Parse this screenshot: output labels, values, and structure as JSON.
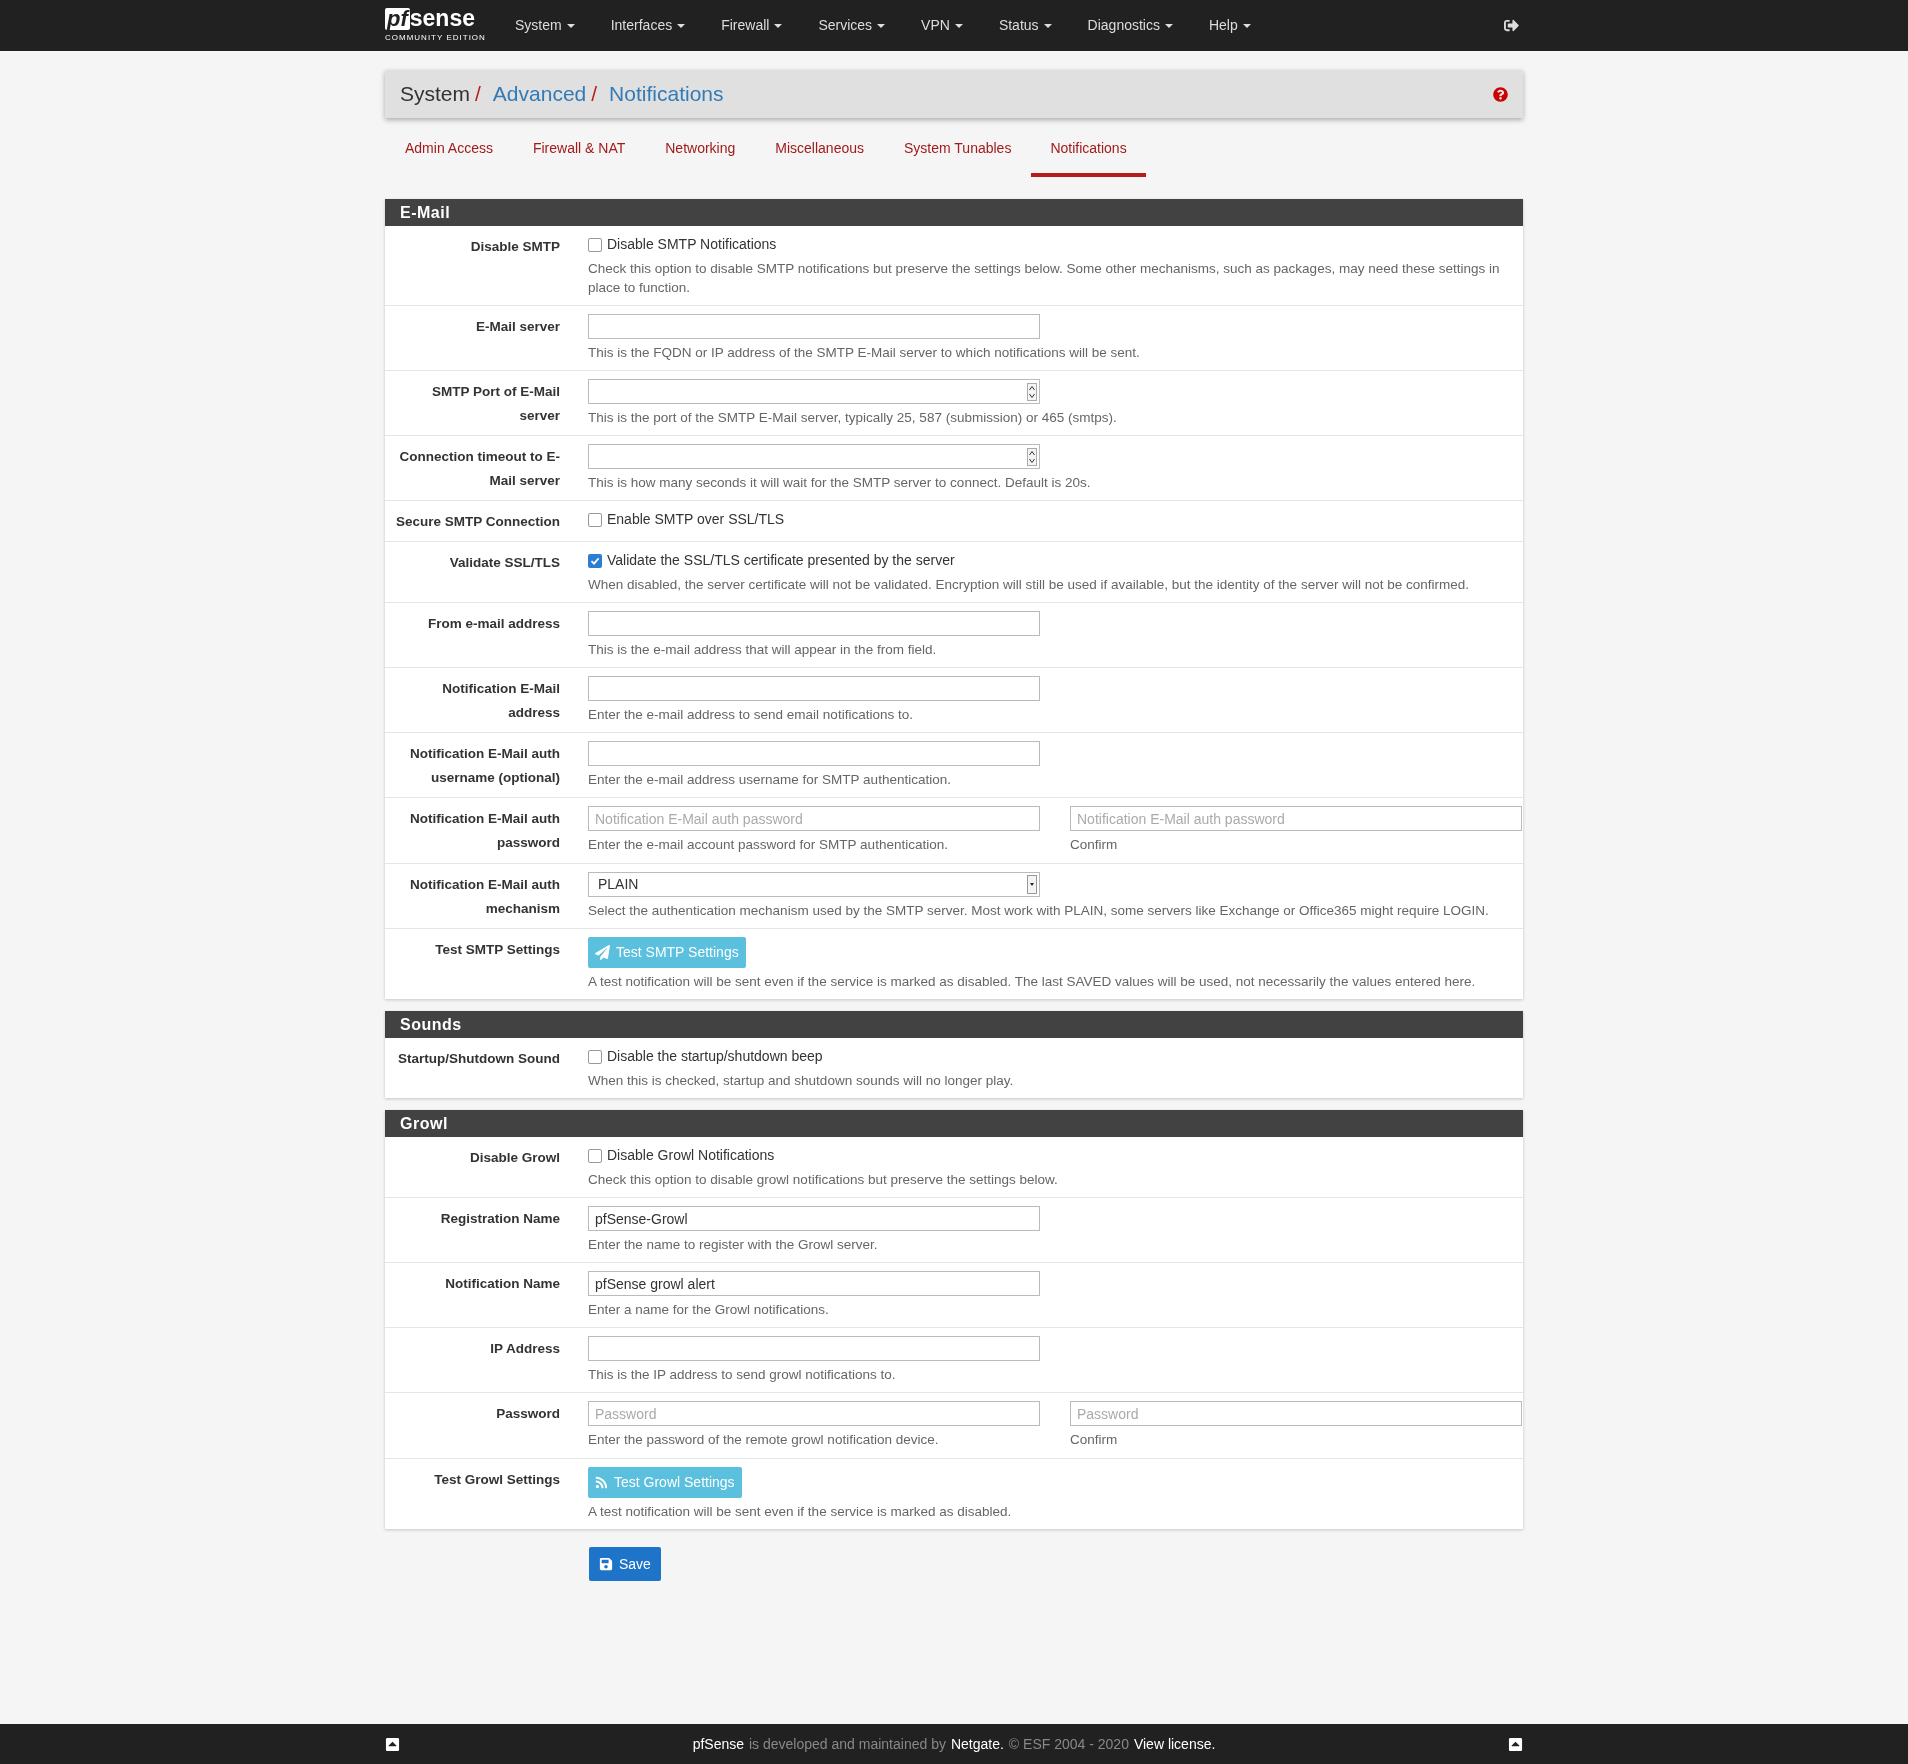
{
  "navbar": {
    "logo": {
      "mark": "pf",
      "word": "sense",
      "edition": "COMMUNITY EDITION"
    },
    "menus": [
      {
        "label": "System"
      },
      {
        "label": "Interfaces"
      },
      {
        "label": "Firewall"
      },
      {
        "label": "Services"
      },
      {
        "label": "VPN"
      },
      {
        "label": "Status"
      },
      {
        "label": "Diagnostics"
      },
      {
        "label": "Help"
      }
    ]
  },
  "breadcrumb": [
    {
      "label": "System",
      "kind": "plain"
    },
    {
      "label": "Advanced",
      "kind": "link"
    },
    {
      "label": "Notifications",
      "kind": "link"
    }
  ],
  "breadcrumb_separator": "/",
  "tabs": [
    {
      "label": "Admin Access",
      "selected": false
    },
    {
      "label": "Firewall & NAT",
      "selected": false
    },
    {
      "label": "Networking",
      "selected": false
    },
    {
      "label": "Miscellaneous",
      "selected": false
    },
    {
      "label": "System Tunables",
      "selected": false
    },
    {
      "label": "Notifications",
      "selected": true
    }
  ],
  "sections": [
    {
      "title": "E-Mail",
      "rows": [
        {
          "label": "Disable SMTP",
          "kind": "checkbox",
          "checkbox_label": "Disable SMTP Notifications",
          "checked": false,
          "help": "Check this option to disable SMTP notifications but preserve the settings below. Some other mechanisms, such as packages, may need these settings in place to function."
        },
        {
          "label": "E-Mail server",
          "kind": "text",
          "help": "This is the FQDN or IP address of the SMTP E-Mail server to which notifications will be sent."
        },
        {
          "label": "SMTP Port of E-Mail server",
          "kind": "number",
          "help": "This is the port of the SMTP E-Mail server, typically 25, 587 (submission) or 465 (smtps)."
        },
        {
          "label": "Connection timeout to E-Mail server",
          "kind": "number",
          "help": "This is how many seconds it will wait for the SMTP server to connect. Default is 20s."
        },
        {
          "label": "Secure SMTP Connection",
          "kind": "checkbox",
          "checkbox_label": "Enable SMTP over SSL/TLS",
          "checked": false
        },
        {
          "label": "Validate SSL/TLS",
          "kind": "checkbox",
          "checkbox_label": "Validate the SSL/TLS certificate presented by the server",
          "checked": true,
          "help": "When disabled, the server certificate will not be validated. Encryption will still be used if available, but the identity of the server will not be confirmed."
        },
        {
          "label": "From e-mail address",
          "kind": "text",
          "help": "This is the e-mail address that will appear in the from field."
        },
        {
          "label": "Notification E-Mail address",
          "kind": "text",
          "help": "Enter the e-mail address to send email notifications to."
        },
        {
          "label": "Notification E-Mail auth username (optional)",
          "kind": "text",
          "help": "Enter the e-mail address username for SMTP authentication."
        },
        {
          "label": "Notification E-Mail auth password",
          "kind": "password",
          "placeholder": "Notification E-Mail auth password",
          "help": "Enter the e-mail account password for SMTP authentication.",
          "confirm_placeholder": "Notification E-Mail auth password",
          "confirm_help": "Confirm"
        },
        {
          "label": "Notification E-Mail auth mechanism",
          "kind": "select",
          "value": "PLAIN",
          "help": "Select the authentication mechanism used by the SMTP server. Most work with PLAIN, some servers like Exchange or Office365 might require LOGIN."
        },
        {
          "label": "Test SMTP Settings",
          "kind": "button",
          "button_label": "Test SMTP Settings",
          "help": "A test notification will be sent even if the service is marked as disabled. The last SAVED values will be used, not necessarily the values entered here."
        }
      ]
    },
    {
      "title": "Sounds",
      "rows": [
        {
          "label": "Startup/Shutdown Sound",
          "kind": "checkbox",
          "checkbox_label": "Disable the startup/shutdown beep",
          "checked": false,
          "help": "When this is checked, startup and shutdown sounds will no longer play."
        }
      ]
    },
    {
      "title": "Growl",
      "rows": [
        {
          "label": "Disable Growl",
          "kind": "checkbox",
          "checkbox_label": "Disable Growl Notifications",
          "checked": false,
          "help": "Check this option to disable growl notifications but preserve the settings below."
        },
        {
          "label": "Registration Name",
          "kind": "text",
          "value": "pfSense-Growl",
          "help": "Enter the name to register with the Growl server."
        },
        {
          "label": "Notification Name",
          "kind": "text",
          "value": "pfSense growl alert",
          "help": "Enter a name for the Growl notifications."
        },
        {
          "label": "IP Address",
          "kind": "text",
          "help": "This is the IP address to send growl notifications to."
        },
        {
          "label": "Password",
          "kind": "password",
          "placeholder": "Password",
          "help": "Enter the password of the remote growl notification device.",
          "confirm_placeholder": "Password",
          "confirm_help": "Confirm"
        },
        {
          "label": "Test Growl Settings",
          "kind": "button",
          "button_label": "Test Growl Settings",
          "help": "A test notification will be sent even if the service is marked as disabled."
        }
      ]
    }
  ],
  "save_button": "Save",
  "footer": [
    {
      "text": "pfSense",
      "kind": "link"
    },
    {
      "text": "is developed and maintained by",
      "kind": "text"
    },
    {
      "text": "Netgate.",
      "kind": "link"
    },
    {
      "text": "© ESF 2004 - 2020",
      "kind": "text"
    },
    {
      "text": "View license.",
      "kind": "link"
    }
  ]
}
